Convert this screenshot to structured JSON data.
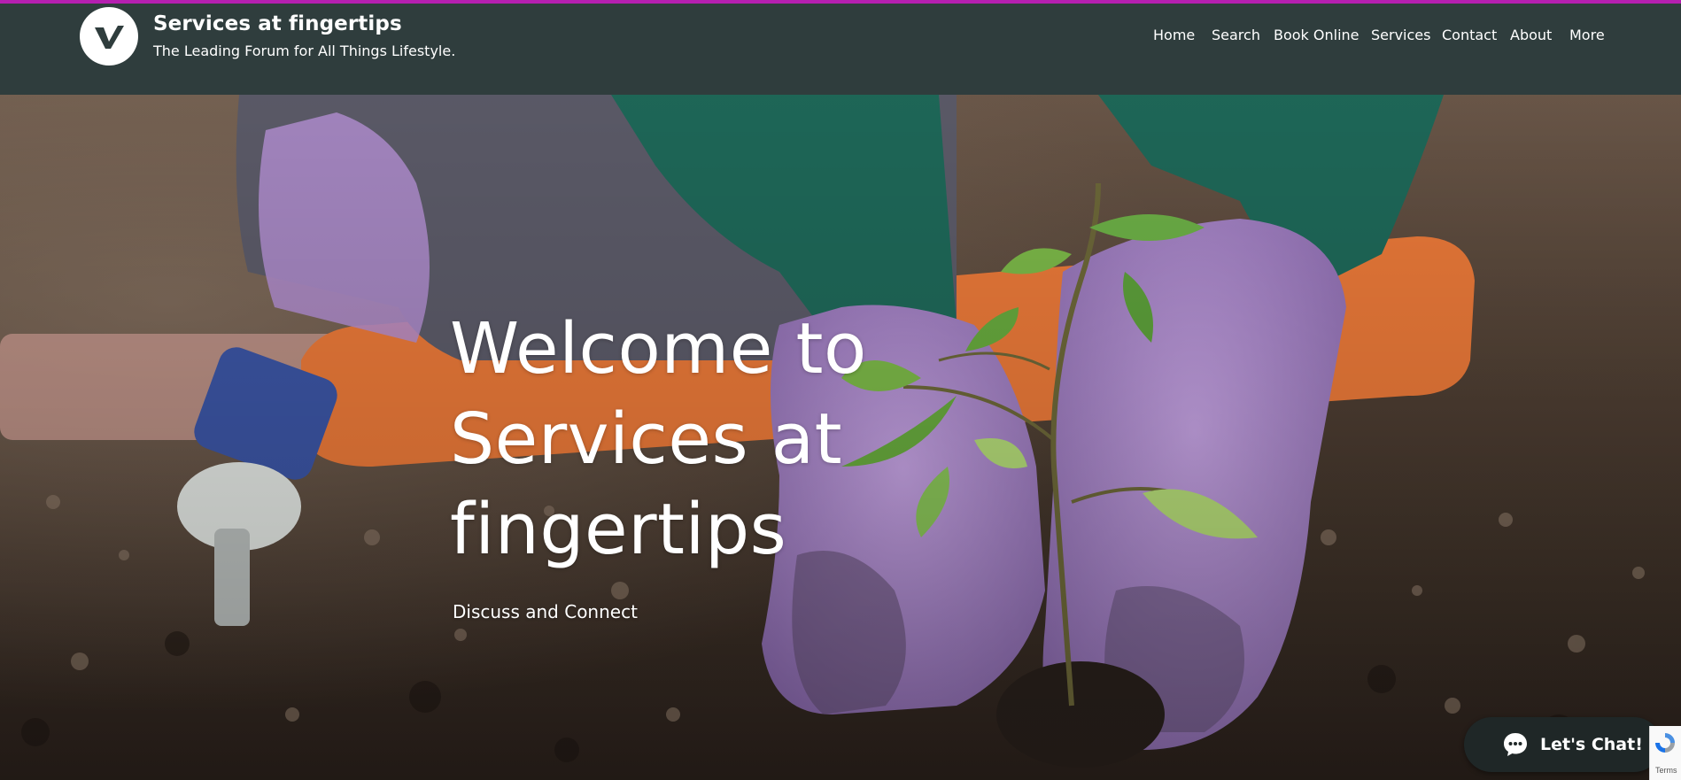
{
  "site": {
    "title": "Services at fingertips",
    "tagline": "The Leading Forum for All Things Lifestyle.",
    "logo_icon": "check-v-logo"
  },
  "nav": {
    "items": [
      {
        "label": "Home"
      },
      {
        "label": "Search"
      },
      {
        "label": "Book Online"
      },
      {
        "label": "Services"
      },
      {
        "label": "Contact"
      },
      {
        "label": "About"
      },
      {
        "label": "More"
      }
    ]
  },
  "hero": {
    "title_lines": [
      "Welcome to",
      "Services at",
      "fingertips"
    ],
    "subtitle": "Discuss and Connect",
    "image_subject": "gloved hands planting a seedling in soil"
  },
  "chat": {
    "label": "Let's Chat!",
    "icon": "chat-bubble-icon"
  },
  "recaptcha": {
    "text": "Terms"
  },
  "colors": {
    "header_bg": "#2f3d3d",
    "accent_line": "#b51fb0",
    "chat_bg": "#1f2727"
  }
}
